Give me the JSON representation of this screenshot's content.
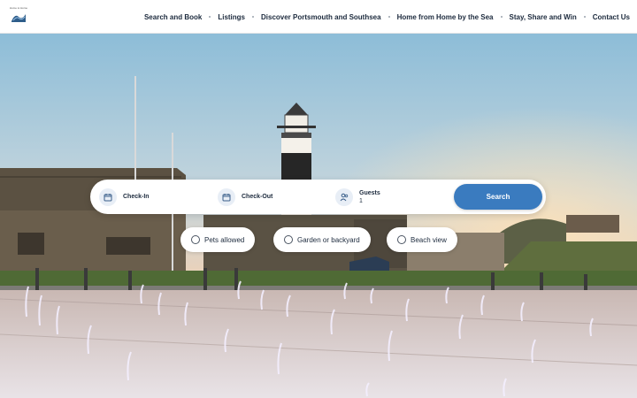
{
  "header": {
    "logo_text": "Home to Home",
    "nav": [
      "Search and Book",
      "Listings",
      "Discover Portsmouth and Southsea",
      "Home from Home by the Sea",
      "Stay, Share and Win",
      "Contact Us"
    ]
  },
  "search": {
    "checkin_label": "Check-In",
    "checkout_label": "Check-Out",
    "guests_label": "Guests",
    "guests_value": "1",
    "button_label": "Search"
  },
  "filters": [
    "Pets allowed",
    "Garden or backyard",
    "Beach view"
  ],
  "colors": {
    "accent": "#3a7bbf",
    "nav_text": "#1c2a3d"
  },
  "icons": {
    "checkin": "calendar-icon",
    "checkout": "calendar-icon",
    "guests": "users-icon"
  }
}
